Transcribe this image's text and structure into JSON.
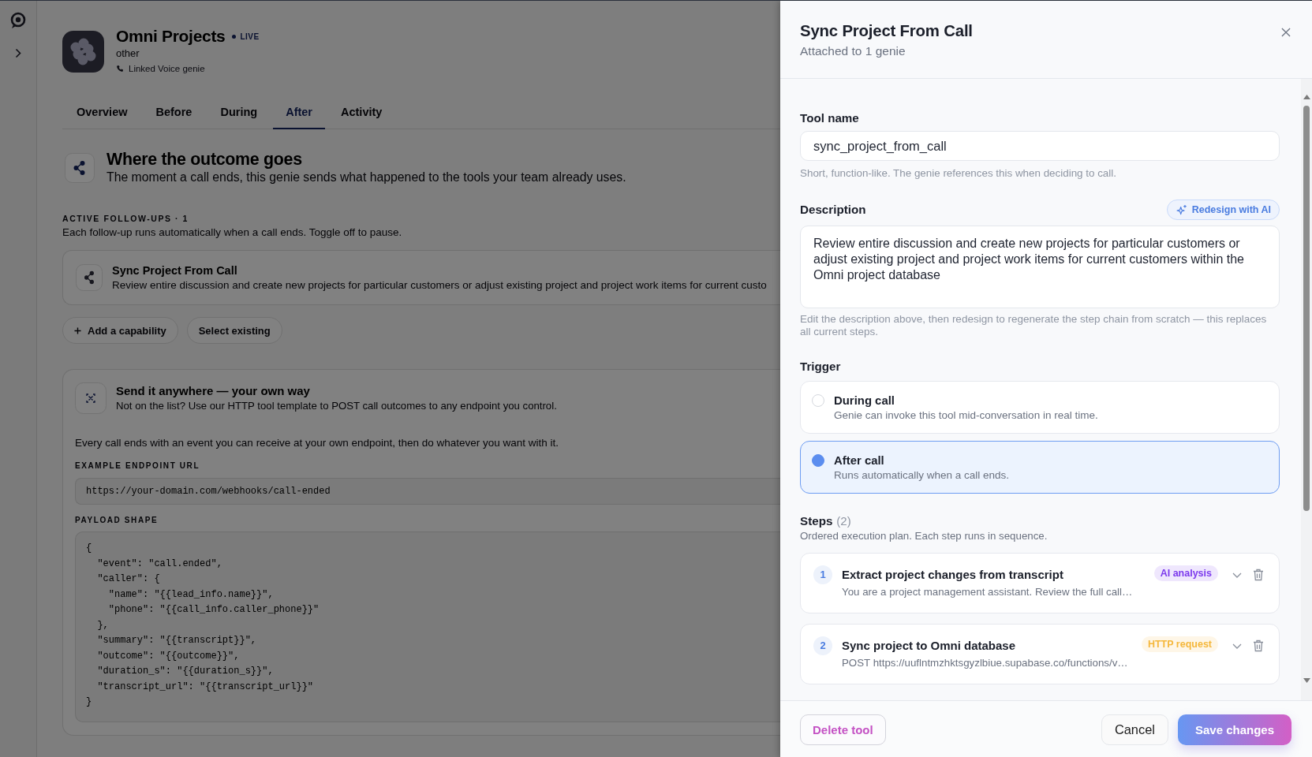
{
  "app": {
    "name": "Omni Projects",
    "status": "LIVE",
    "category": "other",
    "linked": "Linked Voice genie"
  },
  "tabs": [
    {
      "label": "Overview",
      "selected": false
    },
    {
      "label": "Before",
      "selected": false
    },
    {
      "label": "During",
      "selected": false
    },
    {
      "label": "After",
      "selected": true
    },
    {
      "label": "Activity",
      "selected": false
    }
  ],
  "outcome": {
    "title": "Where the outcome goes",
    "subtitle": "The moment a call ends, this genie sends what happened to the tools your team already uses."
  },
  "follow_ups": {
    "heading": "ACTIVE FOLLOW-UPS · 1",
    "hint": "Each follow-up runs automatically when a call ends. Toggle off to pause.",
    "items": [
      {
        "title": "Sync Project From Call",
        "description": "Review entire discussion and create new projects for particular customers or adjust existing project and project work items for current custo"
      }
    ],
    "actions": [
      {
        "label": "Add a capability",
        "kind": "add"
      },
      {
        "label": "Select existing",
        "kind": "plain"
      }
    ]
  },
  "custom_endpoint": {
    "title": "Send it anywhere — your own way",
    "subtitle": "Not on the list? Use our HTTP tool template to POST call outcomes to any endpoint you control.",
    "intro": "Every call ends with an event you can receive at your own endpoint, then do whatever you want with it.",
    "endpoint_label": "EXAMPLE ENDPOINT URL",
    "endpoint_url": "https://your-domain.com/webhooks/call-ended",
    "payload_label": "PAYLOAD SHAPE",
    "payload_lines": [
      "{",
      "  \"event\": \"call.ended\",",
      "  \"caller\": {",
      "    \"name\": \"{{lead_info.name}}\",",
      "    \"phone\": \"{{call_info.caller_phone}}\"",
      "  },",
      "  \"summary\": \"{{transcript}}\",",
      "  \"outcome\": \"{{outcome}}\",",
      "  \"duration_s\": \"{{duration_s}}\",",
      "  \"transcript_url\": \"{{transcript_url}}\"",
      "}"
    ]
  },
  "drawer": {
    "title": "Sync Project From Call",
    "subtitle": "Attached to 1 genie",
    "tool_name": {
      "label": "Tool name",
      "value": "sync_project_from_call",
      "hint": "Short, function-like. The genie references this when deciding to call."
    },
    "description": {
      "label": "Description",
      "action": "Redesign with AI",
      "value": "Review entire discussion and create new projects for particular customers or adjust existing project and project work items for current customers within the Omni project database",
      "hint": "Edit the description above, then redesign to regenerate the step chain from scratch — this replaces all current steps."
    },
    "trigger": {
      "label": "Trigger",
      "options": [
        {
          "title": "During call",
          "description": "Genie can invoke this tool mid-conversation in real time.",
          "selected": false
        },
        {
          "title": "After call",
          "description": "Runs automatically when a call ends.",
          "selected": true
        }
      ]
    },
    "steps": {
      "label": "Steps",
      "count": "(2)",
      "description": "Ordered execution plan. Each step runs in sequence.",
      "items": [
        {
          "number": "1",
          "title": "Extract project changes from transcript",
          "summary": "You are a project management assistant. Review the full call…",
          "type": "AI analysis",
          "color": "#7c3aed"
        },
        {
          "number": "2",
          "title": "Sync project to Omni database",
          "summary": "POST https://uuflntmzhktsgyzlbiue.supabase.co/functions/v…",
          "type": "HTTP request",
          "color": "#f5b73b"
        }
      ]
    },
    "footer": {
      "delete": "Delete tool",
      "cancel": "Cancel",
      "save": "Save changes"
    }
  }
}
